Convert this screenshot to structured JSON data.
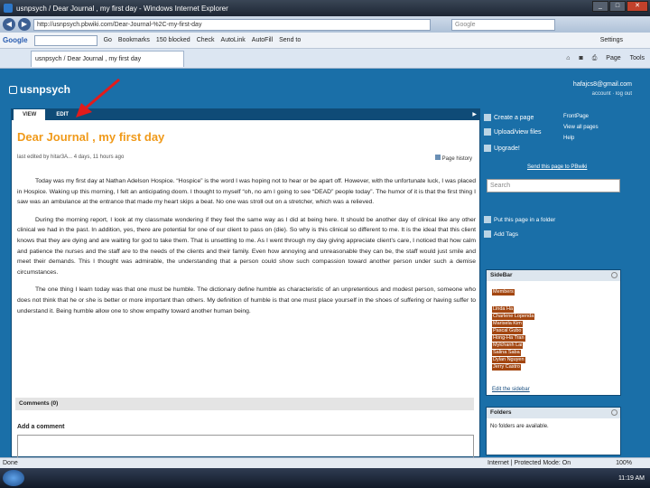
{
  "window": {
    "title": "usnpsych / Dear Journal , my first day - Windows Internet Explorer"
  },
  "address": {
    "url": "http://usnpsych.pbwiki.com/Dear-Journal-%2C-my-first-day",
    "search_placeholder": "Google"
  },
  "google_toolbar": {
    "label": "Google",
    "go": "Go",
    "bookmarks": "Bookmarks",
    "blocked": "150 blocked",
    "check": "Check",
    "autolink": "AutoLink",
    "autofill": "AutoFill",
    "sendto": "Send to",
    "settings": "Settings"
  },
  "tab": {
    "title": "usnpsych / Dear Journal , my first day"
  },
  "cmdbar": {
    "page": "Page",
    "tools": "Tools"
  },
  "site": {
    "name": "usnpsych",
    "email": "hafajcs8@gmail.com",
    "email_links": "account · log out"
  },
  "panel_tabs": {
    "view": "VIEW",
    "edit": "EDIT"
  },
  "page": {
    "title": "Dear Journal , my first day",
    "meta": "last edited by    hitar3A...        4 days, 11 hours ago",
    "history": "Page history",
    "paragraphs": [
      "Today was my first day at Nathan Adelson Hospice. “Hospice” is the word I was hoping not to hear or be apart off. However, with the unfortunate luck, I was placed in Hospice. Waking up this morning, I felt an anticipating doom. I thought to myself “oh, no am I going to see “DEAD” people today”. The humor of it is that the first thing I saw was an ambulance at the entrance that made my heart skips a beat. No one was stroll out on a stretcher, which was a relieved.",
      "During the morning report, I look at my classmate wondering if they feel the same way as I did at being here. It should be another day of clinical like any other clinical we had in the past. In addition, yes, there are potential for one of our client to pass on (die). So why is this clinical so different to me. It is the ideal that this client knows that they are dying and are waiting for god to take them. That is unsettling to me. As I went through my day giving appreciate client’s care, I noticed that how calm and patience the nurses and the staff are to the needs of the clients and their family. Even how annoying and unreasonable they can be, the staff would just smile and meet their demands. This I thought was admirable, the understanding that a person could show such compassion toward another person under such a demise circumstances.",
      "The one thing I learn today was that one must be humble. The dictionary define humble as characteristic of an unpretentious and modest person, someone who does not think that he or she is better or more important than others. My definition of humble is that one must place yourself in the shoes of suffering or having suffer to understand it. Being humble allow one to show empathy toward another human being."
    ],
    "comments": "Comments (0)",
    "add_comment": "Add a comment"
  },
  "sidebar_top": {
    "create": "Create a page",
    "upload": "Upload/view files",
    "upgrade": "Upgrade!",
    "frontpage": "FrontPage",
    "viewall": "View all pages",
    "help": "Help",
    "send": "Send this page to PBwiki",
    "search": "Search",
    "folder": "Put this page in a folder",
    "addtags": "Add Tags"
  },
  "sidebar_widget": {
    "title": "SideBar",
    "members_label": "Members",
    "members": [
      "Linda Ha",
      "Charlene Lopenda",
      "Marisela Kim",
      "Pascal Gubo",
      "Hong-Ha Tran",
      "Mylchanh Lai",
      "Salina Saba",
      "Dylan Nguyen",
      "Jerry Castro"
    ],
    "edit": "Edit the sidebar"
  },
  "folders_widget": {
    "title": "Folders",
    "text": "No folders are available."
  },
  "status": {
    "left": "Done",
    "zone": "Internet | Protected Mode: On",
    "zoom": "100%"
  },
  "taskbar": {
    "time": "11:19 AM"
  },
  "colors": {
    "page_bg": "#1a6fa8",
    "title_orange": "#f09a1a",
    "member_bg": "#a34610",
    "arrow_red": "#e21b1b"
  }
}
